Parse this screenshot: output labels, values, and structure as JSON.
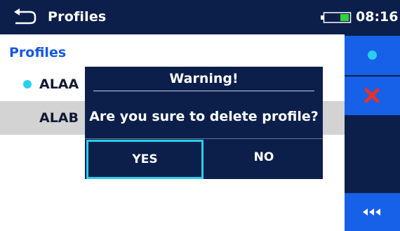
{
  "header": {
    "title": "Profiles",
    "time": "08:16",
    "back_icon": "back-arrow-icon",
    "battery_icon": "battery-icon"
  },
  "content": {
    "section_title": "Profiles",
    "items": [
      {
        "label": "ALAA",
        "active": true
      },
      {
        "label": "ALAB",
        "active": false
      }
    ]
  },
  "sidebar": {
    "buttons": [
      {
        "icon": "active-dot-icon"
      },
      {
        "icon": "delete-x-icon"
      },
      {
        "icon": "collapse-arrows-icon"
      }
    ]
  },
  "dialog": {
    "title": "Warning!",
    "message": "Are you sure to delete profile?",
    "yes_label": "YES",
    "no_label": "NO",
    "focused": "YES"
  },
  "colors": {
    "navy": "#0b1f4a",
    "sidebar_button": "#1661e8",
    "accent_cyan": "#29d0ec",
    "title_blue": "#1558e0",
    "delete_red": "#e8302a",
    "row_selected": "#d3d3d3"
  }
}
